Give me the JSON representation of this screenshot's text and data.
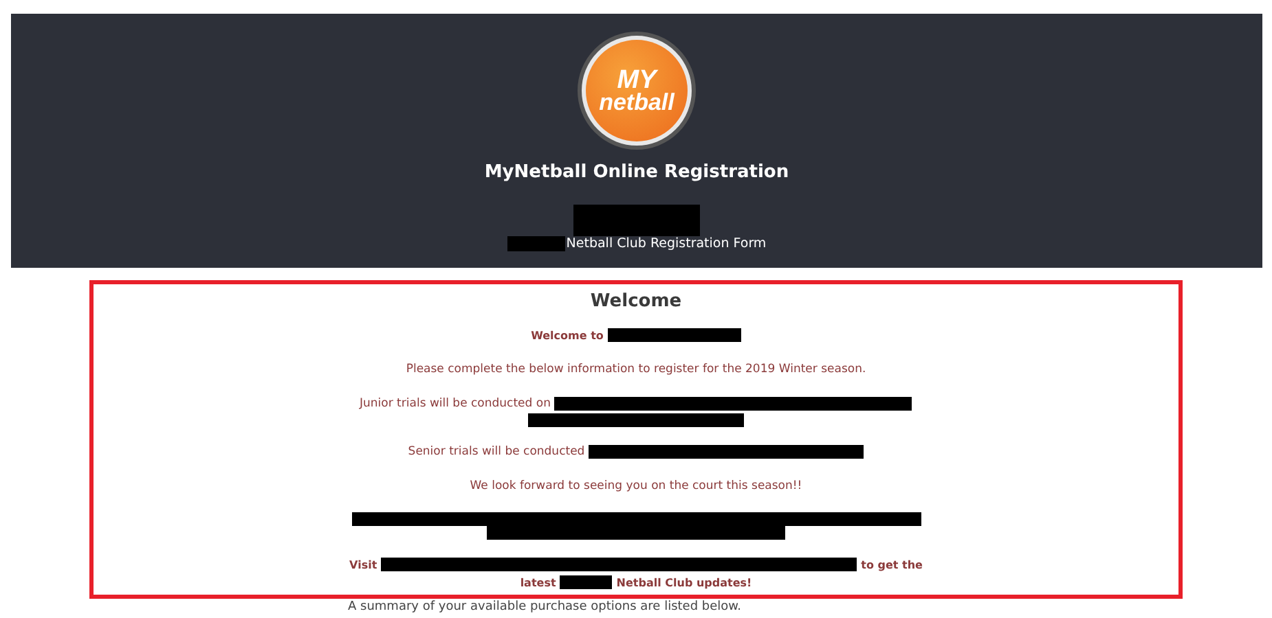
{
  "header": {
    "logo": {
      "line_1": "MY",
      "line_2": "netball"
    },
    "title": "MyNetball Online Registration",
    "lines": [
      [
        {
          "kind": "redacted"
        }
      ],
      [
        {
          "kind": "redacted"
        },
        {
          "kind": "text",
          "text": "Netball Club Registration Form"
        }
      ]
    ]
  },
  "welcome_box": {
    "heading": "Welcome",
    "paragraphs": [
      {
        "bold": true,
        "lines": [
          [
            {
              "kind": "text",
              "text": "Welcome to"
            },
            {
              "kind": "redacted"
            }
          ]
        ]
      },
      {
        "bold": false,
        "lines": [
          [
            {
              "kind": "text",
              "text": "Please complete the below information to register for the 2019 Winter season."
            }
          ]
        ]
      },
      {
        "bold": false,
        "lines": [
          [
            {
              "kind": "text",
              "text": "Junior trials will be conducted on"
            },
            {
              "kind": "redacted"
            }
          ],
          [
            {
              "kind": "redacted"
            }
          ]
        ]
      },
      {
        "bold": false,
        "lines": [
          [
            {
              "kind": "text",
              "text": "Senior trials will be conducted"
            },
            {
              "kind": "redacted"
            }
          ]
        ]
      },
      {
        "bold": false,
        "lines": [
          [
            {
              "kind": "text",
              "text": "We look forward to seeing you on the court this season!!"
            }
          ]
        ]
      },
      {
        "lines": [
          [
            {
              "kind": "redacted"
            }
          ],
          [
            {
              "kind": "redacted"
            }
          ]
        ]
      },
      {
        "bold": true,
        "lines": [
          [
            {
              "kind": "text",
              "text": "Visit"
            },
            {
              "kind": "redacted"
            },
            {
              "kind": "text",
              "text": "to get the"
            }
          ],
          [
            {
              "kind": "text",
              "text": "latest"
            },
            {
              "kind": "redacted"
            },
            {
              "kind": "text",
              "text": "Netball Club updates!"
            }
          ]
        ]
      }
    ]
  },
  "summary": "A summary of your available purchase options are listed below."
}
